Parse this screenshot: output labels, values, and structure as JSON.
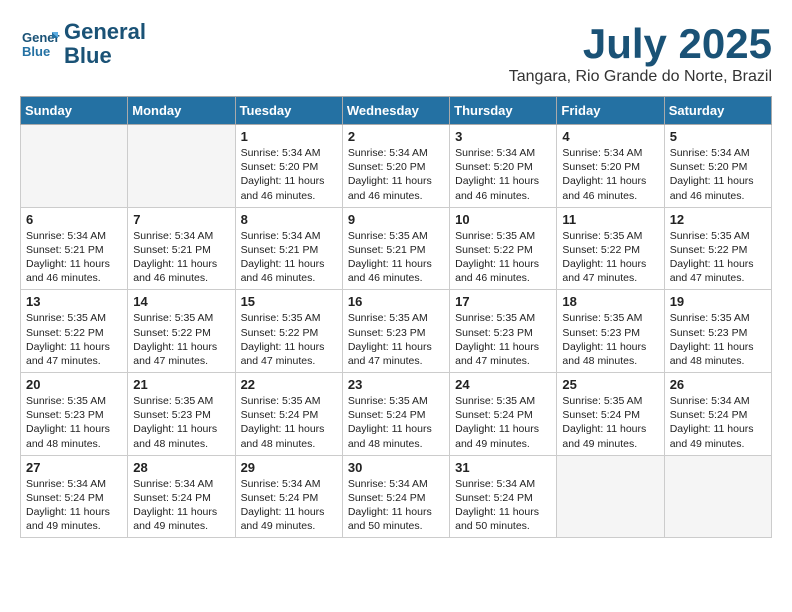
{
  "logo": {
    "line1": "General",
    "line2": "Blue"
  },
  "title": "July 2025",
  "location": "Tangara, Rio Grande do Norte, Brazil",
  "days_of_week": [
    "Sunday",
    "Monday",
    "Tuesday",
    "Wednesday",
    "Thursday",
    "Friday",
    "Saturday"
  ],
  "weeks": [
    [
      {
        "day": "",
        "info": ""
      },
      {
        "day": "",
        "info": ""
      },
      {
        "day": "1",
        "info": "Sunrise: 5:34 AM\nSunset: 5:20 PM\nDaylight: 11 hours and 46 minutes."
      },
      {
        "day": "2",
        "info": "Sunrise: 5:34 AM\nSunset: 5:20 PM\nDaylight: 11 hours and 46 minutes."
      },
      {
        "day": "3",
        "info": "Sunrise: 5:34 AM\nSunset: 5:20 PM\nDaylight: 11 hours and 46 minutes."
      },
      {
        "day": "4",
        "info": "Sunrise: 5:34 AM\nSunset: 5:20 PM\nDaylight: 11 hours and 46 minutes."
      },
      {
        "day": "5",
        "info": "Sunrise: 5:34 AM\nSunset: 5:20 PM\nDaylight: 11 hours and 46 minutes."
      }
    ],
    [
      {
        "day": "6",
        "info": "Sunrise: 5:34 AM\nSunset: 5:21 PM\nDaylight: 11 hours and 46 minutes."
      },
      {
        "day": "7",
        "info": "Sunrise: 5:34 AM\nSunset: 5:21 PM\nDaylight: 11 hours and 46 minutes."
      },
      {
        "day": "8",
        "info": "Sunrise: 5:34 AM\nSunset: 5:21 PM\nDaylight: 11 hours and 46 minutes."
      },
      {
        "day": "9",
        "info": "Sunrise: 5:35 AM\nSunset: 5:21 PM\nDaylight: 11 hours and 46 minutes."
      },
      {
        "day": "10",
        "info": "Sunrise: 5:35 AM\nSunset: 5:22 PM\nDaylight: 11 hours and 46 minutes."
      },
      {
        "day": "11",
        "info": "Sunrise: 5:35 AM\nSunset: 5:22 PM\nDaylight: 11 hours and 47 minutes."
      },
      {
        "day": "12",
        "info": "Sunrise: 5:35 AM\nSunset: 5:22 PM\nDaylight: 11 hours and 47 minutes."
      }
    ],
    [
      {
        "day": "13",
        "info": "Sunrise: 5:35 AM\nSunset: 5:22 PM\nDaylight: 11 hours and 47 minutes."
      },
      {
        "day": "14",
        "info": "Sunrise: 5:35 AM\nSunset: 5:22 PM\nDaylight: 11 hours and 47 minutes."
      },
      {
        "day": "15",
        "info": "Sunrise: 5:35 AM\nSunset: 5:22 PM\nDaylight: 11 hours and 47 minutes."
      },
      {
        "day": "16",
        "info": "Sunrise: 5:35 AM\nSunset: 5:23 PM\nDaylight: 11 hours and 47 minutes."
      },
      {
        "day": "17",
        "info": "Sunrise: 5:35 AM\nSunset: 5:23 PM\nDaylight: 11 hours and 47 minutes."
      },
      {
        "day": "18",
        "info": "Sunrise: 5:35 AM\nSunset: 5:23 PM\nDaylight: 11 hours and 48 minutes."
      },
      {
        "day": "19",
        "info": "Sunrise: 5:35 AM\nSunset: 5:23 PM\nDaylight: 11 hours and 48 minutes."
      }
    ],
    [
      {
        "day": "20",
        "info": "Sunrise: 5:35 AM\nSunset: 5:23 PM\nDaylight: 11 hours and 48 minutes."
      },
      {
        "day": "21",
        "info": "Sunrise: 5:35 AM\nSunset: 5:23 PM\nDaylight: 11 hours and 48 minutes."
      },
      {
        "day": "22",
        "info": "Sunrise: 5:35 AM\nSunset: 5:24 PM\nDaylight: 11 hours and 48 minutes."
      },
      {
        "day": "23",
        "info": "Sunrise: 5:35 AM\nSunset: 5:24 PM\nDaylight: 11 hours and 48 minutes."
      },
      {
        "day": "24",
        "info": "Sunrise: 5:35 AM\nSunset: 5:24 PM\nDaylight: 11 hours and 49 minutes."
      },
      {
        "day": "25",
        "info": "Sunrise: 5:35 AM\nSunset: 5:24 PM\nDaylight: 11 hours and 49 minutes."
      },
      {
        "day": "26",
        "info": "Sunrise: 5:34 AM\nSunset: 5:24 PM\nDaylight: 11 hours and 49 minutes."
      }
    ],
    [
      {
        "day": "27",
        "info": "Sunrise: 5:34 AM\nSunset: 5:24 PM\nDaylight: 11 hours and 49 minutes."
      },
      {
        "day": "28",
        "info": "Sunrise: 5:34 AM\nSunset: 5:24 PM\nDaylight: 11 hours and 49 minutes."
      },
      {
        "day": "29",
        "info": "Sunrise: 5:34 AM\nSunset: 5:24 PM\nDaylight: 11 hours and 49 minutes."
      },
      {
        "day": "30",
        "info": "Sunrise: 5:34 AM\nSunset: 5:24 PM\nDaylight: 11 hours and 50 minutes."
      },
      {
        "day": "31",
        "info": "Sunrise: 5:34 AM\nSunset: 5:24 PM\nDaylight: 11 hours and 50 minutes."
      },
      {
        "day": "",
        "info": ""
      },
      {
        "day": "",
        "info": ""
      }
    ]
  ]
}
